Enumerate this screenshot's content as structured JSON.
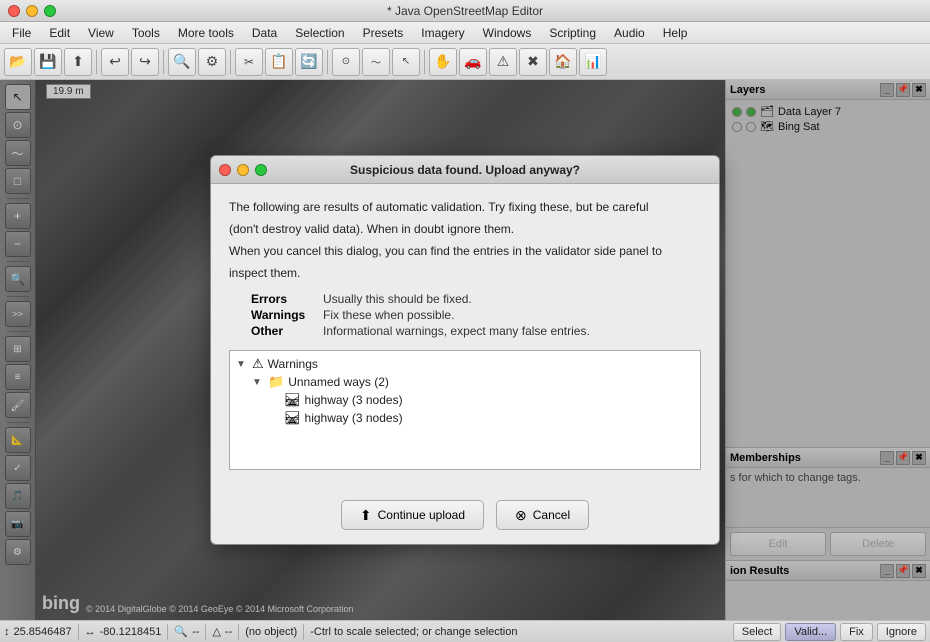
{
  "window": {
    "title": "* Java OpenStreetMap Editor",
    "controls": [
      "close",
      "minimize",
      "maximize"
    ]
  },
  "menubar": {
    "items": [
      "File",
      "Edit",
      "View",
      "Tools",
      "More tools",
      "Data",
      "Selection",
      "Presets",
      "Imagery",
      "Windows",
      "Scripting",
      "Audio",
      "Help"
    ]
  },
  "toolbar": {
    "buttons": [
      "📂",
      "💾",
      "⬆",
      "↩",
      "↪",
      "🔍",
      "⚙",
      "✂",
      "📋",
      "🔄",
      "🖨",
      "⚙",
      "⚙",
      "⚙",
      "✋",
      "🚗",
      "✈",
      "⚠",
      "✖",
      "🏠",
      "📊"
    ]
  },
  "scale": {
    "label": "19.9 m"
  },
  "map": {
    "copyright": "© 2014 DigitalGlobe © 2014 GeoEye © 2014 Microsoft Corporation"
  },
  "layers_panel": {
    "title": "Layers",
    "items": [
      {
        "name": "Data Layer 7",
        "type": "data",
        "visible": true
      },
      {
        "name": "Bing Sat",
        "type": "imagery",
        "visible": true
      }
    ]
  },
  "memberships_panel": {
    "title": "Memberships"
  },
  "tags_hint": "s for which to change tags.",
  "edit_button": "Edit",
  "delete_button": "Delete",
  "validation_panel": {
    "title": "ion Results"
  },
  "statusbar": {
    "coords": "25.8546487",
    "lon": "-80.1218451",
    "zoom": "--",
    "angle": "--",
    "object": "(no object)",
    "hint": "-Ctrl to scale selected; or change selection",
    "buttons": [
      "Select",
      "Valid...",
      "Fix",
      "Ignore"
    ]
  },
  "dialog": {
    "title": "Suspicious data found. Upload anyway?",
    "intro1": "The following are results of automatic validation. Try fixing these, but be careful",
    "intro2": "(don't destroy valid data). When in doubt ignore them.",
    "intro3": "When you cancel this dialog, you can find the entries in the validator side panel to",
    "intro4": "inspect them.",
    "errors_label": "Errors",
    "errors_desc": "Usually this should be fixed.",
    "warnings_label": "Warnings",
    "warnings_desc": "Fix these when possible.",
    "other_label": "Other",
    "other_desc": "Informational warnings, expect many false entries.",
    "tree": {
      "root": {
        "label": "Warnings",
        "children": [
          {
            "label": "Unnamed ways (2)",
            "children": [
              {
                "label": "highway (3 nodes)"
              },
              {
                "label": "highway (3 nodes)"
              }
            ]
          }
        ]
      }
    },
    "continue_button": "Continue upload",
    "cancel_button": "Cancel"
  }
}
